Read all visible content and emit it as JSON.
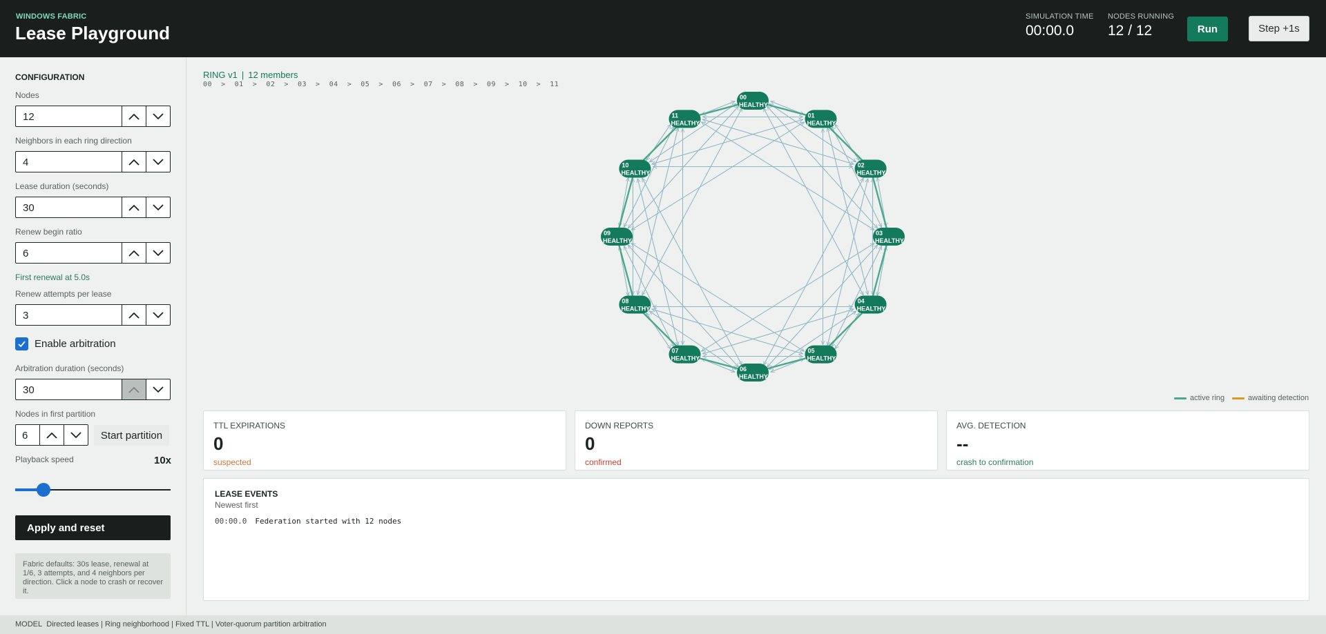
{
  "header": {
    "brand": "WINDOWS FABRIC",
    "title": "Lease Playground",
    "sim_time_label": "SIMULATION TIME",
    "sim_time": "00:00.0",
    "nodes_running_label": "NODES RUNNING",
    "nodes_running": "12 / 12",
    "run_label": "Run",
    "step_label": "Step +1s"
  },
  "config": {
    "title": "CONFIGURATION",
    "nodes_label": "Nodes",
    "nodes_value": "12",
    "neighbors_label": "Neighbors in each ring direction",
    "neighbors_value": "4",
    "lease_label": "Lease duration (seconds)",
    "lease_value": "30",
    "renew_ratio_label": "Renew begin ratio",
    "renew_ratio_value": "6",
    "first_renewal": "First renewal at 5.0s",
    "attempts_label": "Renew attempts per lease",
    "attempts_value": "3",
    "arbitration_checked": true,
    "arbitration_label": "Enable arbitration",
    "arb_duration_label": "Arbitration duration (seconds)",
    "arb_duration_value": "30",
    "partition_label": "Nodes in first partition",
    "partition_value": "6",
    "start_partition_label": "Start partition",
    "speed_label": "Playback speed",
    "speed_value": "10x",
    "speed_fraction": 0.18,
    "apply_label": "Apply and reset",
    "note": "Fabric defaults: 30s lease, renewal at 1/6, 3 attempts, and 4 neighbors per direction. Click a node to crash or recover it."
  },
  "ring": {
    "version": "RING v1",
    "members": "12 members",
    "order": [
      "00",
      "01",
      "02",
      "03",
      "04",
      "05",
      "06",
      "07",
      "08",
      "09",
      "10",
      "11"
    ],
    "order_sep": ">",
    "neighbors_per_direction": 4,
    "nodes": [
      {
        "id": "00",
        "status": "HEALTHY"
      },
      {
        "id": "01",
        "status": "HEALTHY"
      },
      {
        "id": "02",
        "status": "HEALTHY"
      },
      {
        "id": "03",
        "status": "HEALTHY"
      },
      {
        "id": "04",
        "status": "HEALTHY"
      },
      {
        "id": "05",
        "status": "HEALTHY"
      },
      {
        "id": "06",
        "status": "HEALTHY"
      },
      {
        "id": "07",
        "status": "HEALTHY"
      },
      {
        "id": "08",
        "status": "HEALTHY"
      },
      {
        "id": "09",
        "status": "HEALTHY"
      },
      {
        "id": "10",
        "status": "HEALTHY"
      },
      {
        "id": "11",
        "status": "HEALTHY"
      }
    ],
    "colors": {
      "node": "#137a5c",
      "active_ring": "#4aa88c",
      "lease_edge": "#8fb6c4",
      "awaiting": "#d99a1e"
    }
  },
  "legend": {
    "active": "active ring",
    "awaiting": "awaiting detection"
  },
  "metrics": [
    {
      "title": "TTL EXPIRATIONS",
      "value": "0",
      "sub": "suspected",
      "sub_color": "#d0733a"
    },
    {
      "title": "DOWN REPORTS",
      "value": "0",
      "sub": "confirmed",
      "sub_color": "#c8402f"
    },
    {
      "title": "AVG. DETECTION",
      "value": "--",
      "sub": "crash to confirmation",
      "sub_color": "#2f7a60"
    }
  ],
  "events": {
    "title": "LEASE EVENTS",
    "subtitle": "Newest first",
    "rows": [
      {
        "time": "00:00.0",
        "text": "Federation started with 12 nodes"
      }
    ]
  },
  "footer": {
    "label": "MODEL",
    "text": "Directed leases | Ring neighborhood | Fixed TTL | Voter-quorum partition arbitration"
  }
}
